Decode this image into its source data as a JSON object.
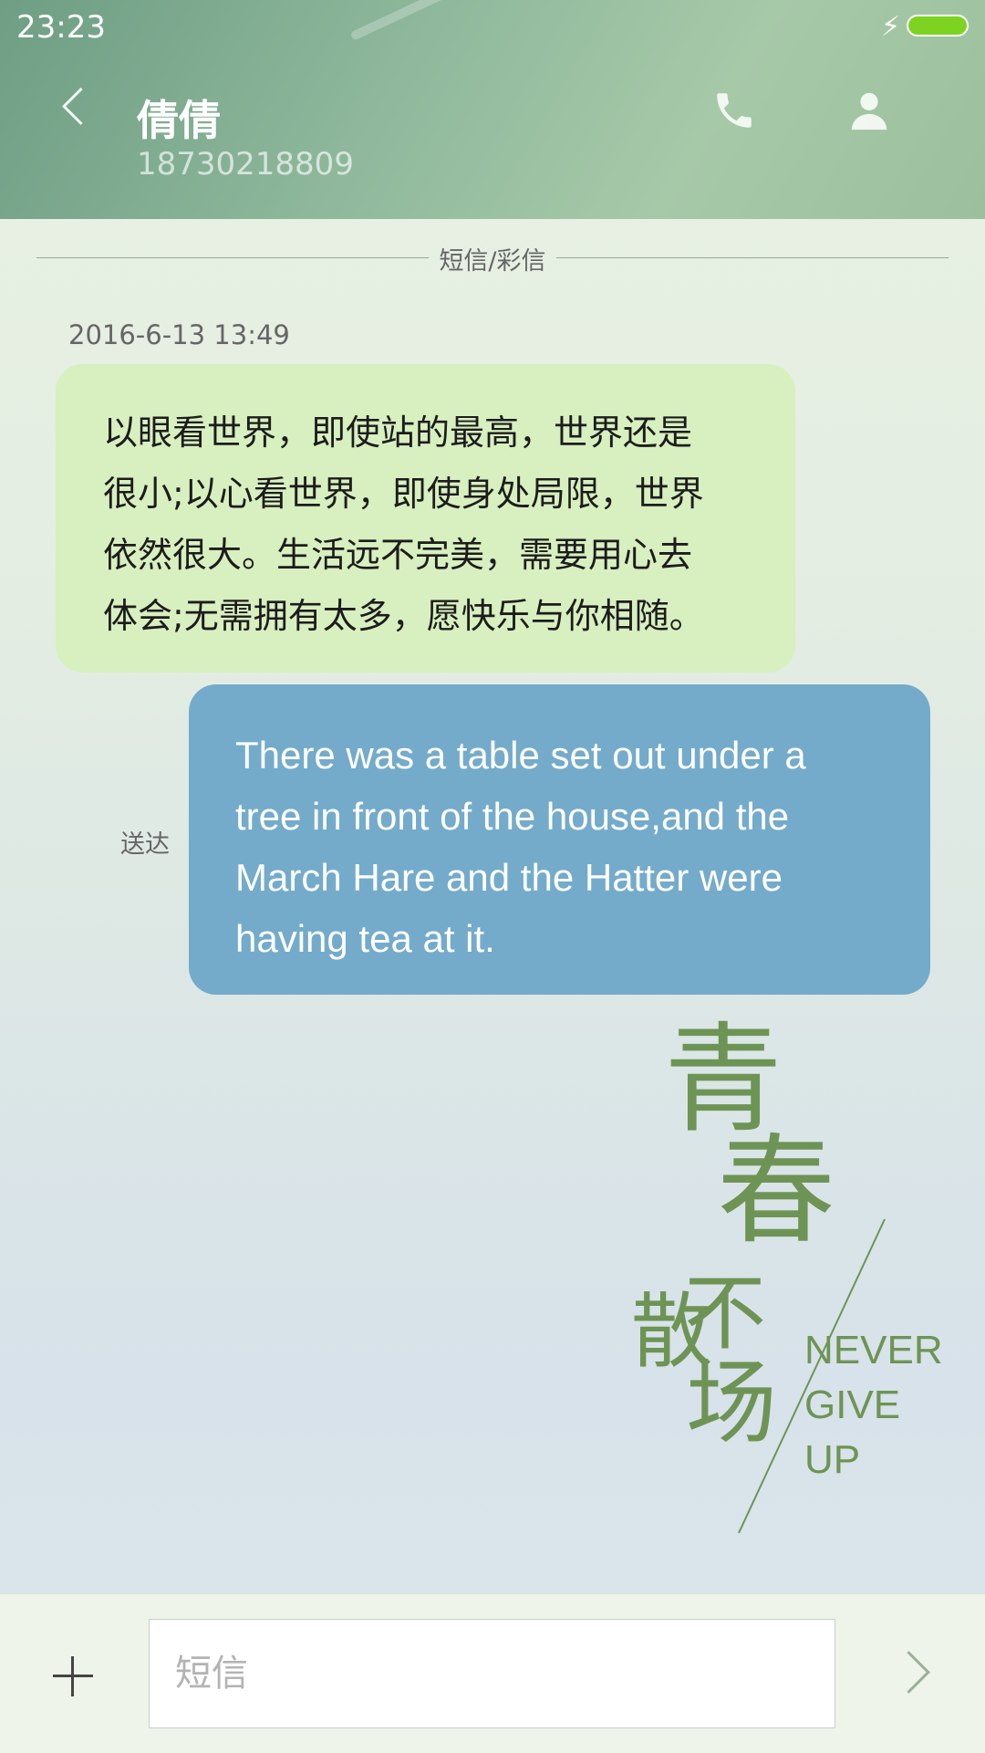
{
  "status_bar": {
    "time": "23:23",
    "bolt": "⚡"
  },
  "header": {
    "contact_name": "倩倩",
    "contact_number": "18730218809",
    "icons": {
      "back": "back-chevron-icon",
      "call": "phone-icon",
      "profile": "person-icon"
    }
  },
  "conversation": {
    "channel_label": "短信/彩信",
    "timestamp": "2016-6-13 13:49",
    "messages": [
      {
        "direction": "incoming",
        "lines": [
          "以眼看世界，即使站的最高，世界还是",
          "很小;以心看世界，即使身处局限，世界",
          "依然很大。生活远不完美，需要用心去",
          "体会;无需拥有太多，愿快乐与你相随。"
        ]
      },
      {
        "direction": "outgoing",
        "status": "送达",
        "lines": [
          "There was a table set out under a",
          "tree in front of the house,and the",
          "March Hare and the Hatter were",
          "having tea at it."
        ]
      }
    ]
  },
  "wallpaper": {
    "chars": [
      "青",
      "春",
      "不",
      "散",
      "场"
    ],
    "words": [
      "NEVER",
      "GIVE",
      "UP"
    ],
    "color": "#6e9455"
  },
  "composer": {
    "placeholder": "短信",
    "value": ""
  },
  "colors": {
    "incoming_bubble": "#d8efbf",
    "outgoing_bubble": "#74abca",
    "header": "#8fb89c"
  }
}
